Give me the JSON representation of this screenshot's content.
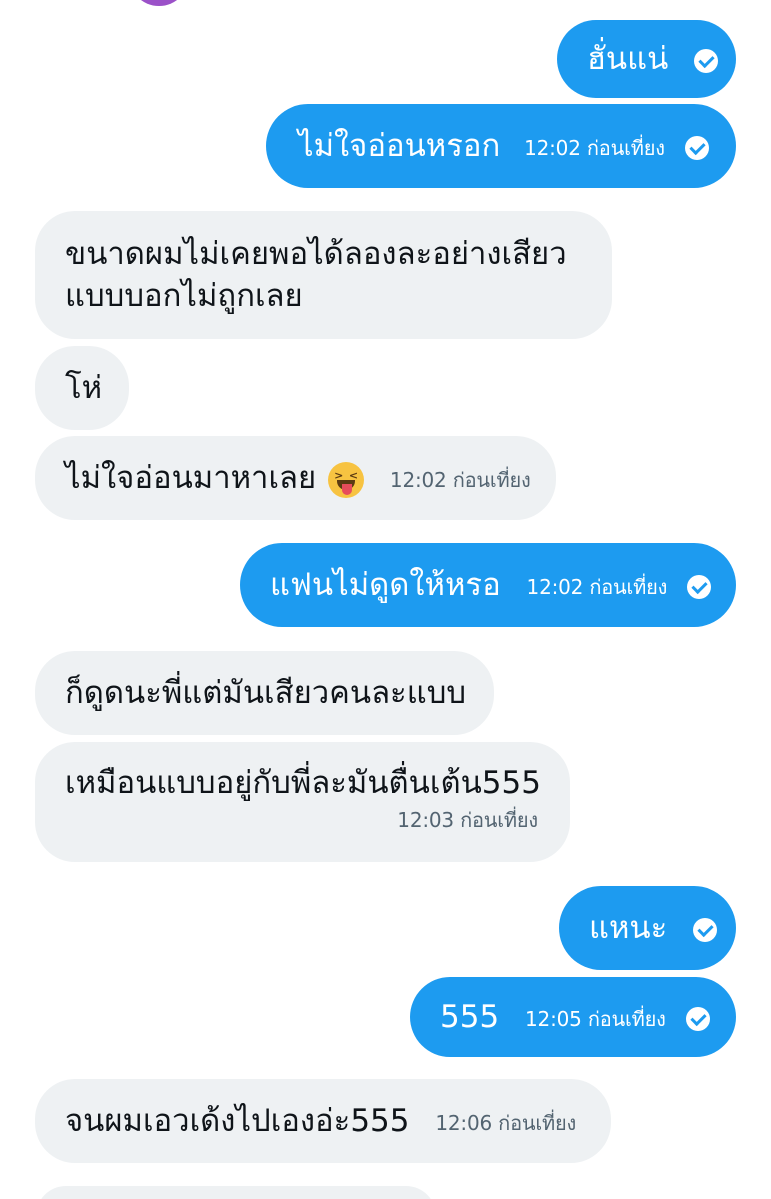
{
  "conversation": {
    "messages": [
      {
        "direction": "out",
        "text": "ฮั่นแน่",
        "time": ""
      },
      {
        "direction": "out",
        "text": "ไม่ใจอ่อนหรอก",
        "time": "12:02 ก่อนเที่ยง"
      },
      {
        "direction": "in",
        "text_line1": "ขนาดผมไม่เคยพอได้ลองละอย่างเสียว",
        "text_line2": "แบบบอกไม่ถูกเลย"
      },
      {
        "direction": "in",
        "text": "โห่"
      },
      {
        "direction": "in",
        "text": "ไม่ใจอ่อนมาหาเลย",
        "emoji": "squinting-face-with-tongue",
        "time": "12:02 ก่อนเที่ยง"
      },
      {
        "direction": "out",
        "text": "แฟนไม่ดูดให้หรอ",
        "time": "12:02 ก่อนเที่ยง"
      },
      {
        "direction": "in",
        "text": "ก็ดูดนะพี่แต่มันเสียวคนละแบบ"
      },
      {
        "direction": "in",
        "text": "เหมือนแบบอยู่กับพี่ละมันตื่นเต้น555",
        "time": "12:03 ก่อนเที่ยง"
      },
      {
        "direction": "out",
        "text": "แหนะ",
        "time": ""
      },
      {
        "direction": "out",
        "text": "555",
        "time": "12:05 ก่อนเที่ยง"
      },
      {
        "direction": "in",
        "text": "จนผมเอวเด้งไปเองอ่ะ555",
        "time": "12:06 ก่อนเที่ยง"
      }
    ]
  },
  "icons": {
    "read_receipt": "check-circle-icon",
    "emoji": "squinting-face-with-tongue"
  },
  "colors": {
    "outgoing_bubble": "#1d9bf0",
    "incoming_bubble": "#eef1f3",
    "timestamp": "#536471",
    "avatar": "#9b51c8"
  }
}
